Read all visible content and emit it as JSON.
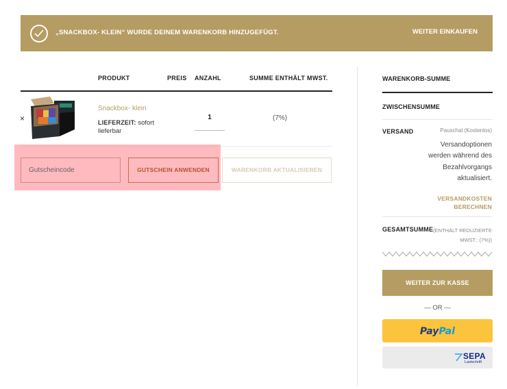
{
  "notice": {
    "message": "„SNACKBOX- KLEIN“ WURDE DEINEM WARENKORB HINZUGEFÜGT.",
    "continue_label": "WEITER EINKAUFEN"
  },
  "cart": {
    "headers": {
      "product": "PRODUKT",
      "price": "PREIS",
      "quantity": "ANZAHL",
      "sum": "SUMME ENTHÄLT MWST."
    },
    "items": [
      {
        "remove": "×",
        "name": "Snackbox- klein",
        "delivery_label": "LIEFERZEIT:",
        "delivery_value": "sofort lieferbar",
        "quantity": "1",
        "tax": "(7%)"
      }
    ],
    "coupon_placeholder": "Gutscheincode",
    "apply_label": "GUTSCHEIN ANWENDEN",
    "update_label": "WARENKORB AKTUALISIEREN"
  },
  "totals": {
    "title": "WARENKORB-SUMME",
    "subtotal_label": "ZWISCHENSUMME",
    "shipping_label": "VERSAND",
    "shipping_method": "Pauschal (Kostenlos)",
    "shipping_text": "Versandoptionen werden während des Bezahlvorgangs aktualisiert.",
    "calc_label": "VERSANDKOSTEN BERECHNEN",
    "total_label": "GESAMTSUMME",
    "total_note": "(ENTHÄLT REDUZIERTE MWST.: (7%))",
    "checkout_label": "WEITER ZUR KASSE",
    "or_label": "— OR —",
    "paypal_label_1": "Pay",
    "paypal_label_2": "Pal",
    "sepa_label": "SEPA",
    "sepa_sub": "Lastschrift"
  },
  "colors": {
    "accent": "#b59c62",
    "highlight": "#ff8c96",
    "paypal": "#fcc33c"
  }
}
